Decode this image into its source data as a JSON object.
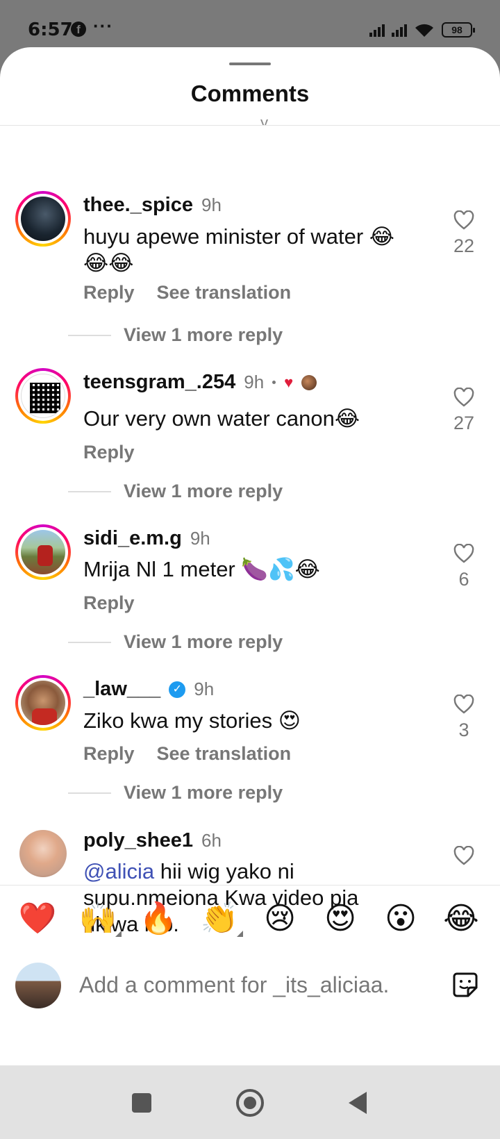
{
  "status_bar": {
    "time": "6:57",
    "app_icon": "facebook-icon",
    "more": "···",
    "battery": "98"
  },
  "sheet": {
    "title": "Comments"
  },
  "comments": [
    {
      "username": "thee._spice",
      "time": "9h",
      "text": "huyu apewe minister of water 😂😂😂",
      "actions": [
        "Reply",
        "See translation"
      ],
      "likes": "22",
      "more_replies": "View 1 more reply"
    },
    {
      "username": "teensgram_.254",
      "time": "9h",
      "text": "Our very own water canon😂",
      "actions": [
        "Reply"
      ],
      "likes": "27",
      "more_replies": "View 1 more reply"
    },
    {
      "username": "sidi_e.m.g",
      "time": "9h",
      "text": "Mrija Nl 1 meter 🍆💦😂",
      "actions": [
        "Reply"
      ],
      "likes": "6",
      "more_replies": "View 1 more reply"
    },
    {
      "username": "_law___",
      "time": "9h",
      "text": "Ziko kwa my stories 😍",
      "actions": [
        "Reply",
        "See translation"
      ],
      "likes": "3",
      "more_replies": "View 1 more reply"
    },
    {
      "username": "poly_shee1",
      "time": "6h",
      "mention": "@alicia",
      "text": " hii wig yako ni supu.nmeiona Kwa video pia ukiwa job.",
      "likes": ""
    }
  ],
  "reactions": [
    "❤️",
    "🙌",
    "🔥",
    "👏",
    "😢",
    "😍",
    "😮",
    "😂"
  ],
  "input": {
    "placeholder": "Add a comment for _its_aliciaa."
  },
  "colors": {
    "like_heart": "#e01e3c",
    "mention": "#3f51b5",
    "verified": "#1d9bf0"
  }
}
